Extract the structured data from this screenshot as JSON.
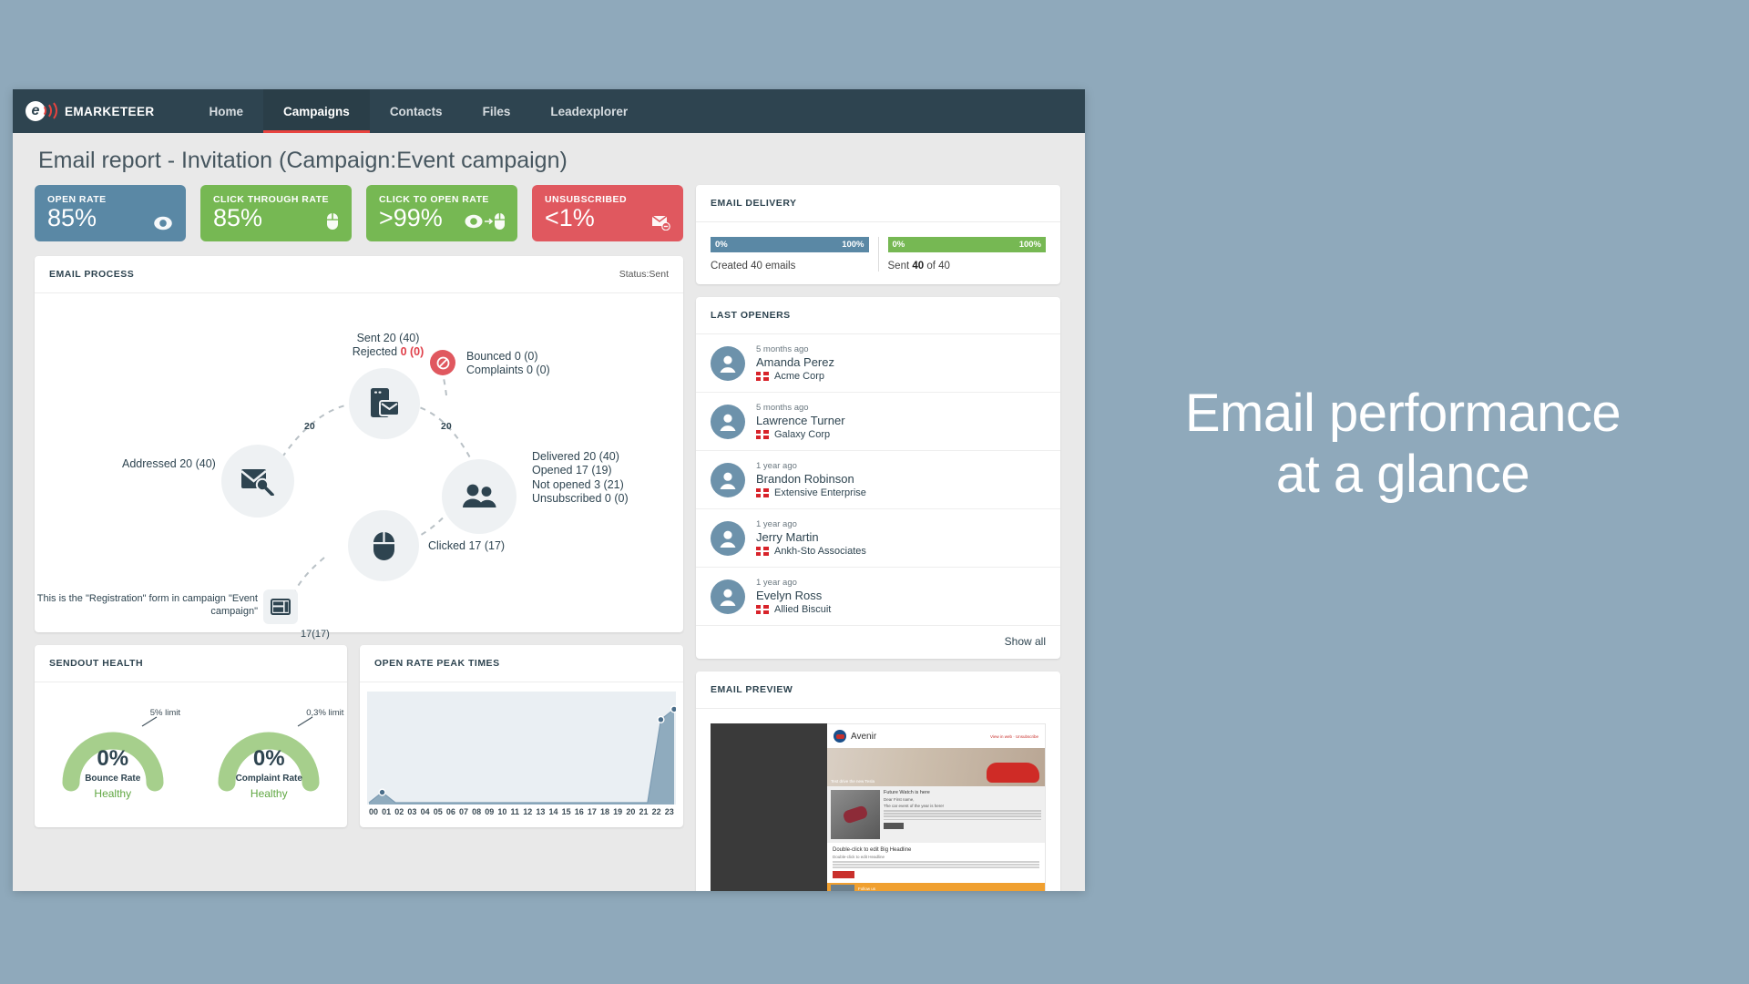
{
  "promo": {
    "line1": "Email performance",
    "line2": "at a glance"
  },
  "nav": {
    "brand": "EMARKETEER",
    "items": [
      {
        "label": "Home",
        "active": false
      },
      {
        "label": "Campaigns",
        "active": true
      },
      {
        "label": "Contacts",
        "active": false
      },
      {
        "label": "Files",
        "active": false
      },
      {
        "label": "Leadexplorer",
        "active": false
      }
    ]
  },
  "page": {
    "title": "Email report - Invitation (Campaign:Event campaign)"
  },
  "kpis": [
    {
      "label": "OPEN RATE",
      "value": "85%",
      "color": "#5a88a5",
      "icon": "eye-icon"
    },
    {
      "label": "CLICK THROUGH RATE",
      "value": "85%",
      "color": "#76b853",
      "icon": "mouse-icon"
    },
    {
      "label": "CLICK TO OPEN RATE",
      "value": ">99%",
      "color": "#76b853",
      "icon": "eye-to-mouse-icon"
    },
    {
      "label": "UNSUBSCRIBED",
      "value": "<1%",
      "color": "#e0585f",
      "icon": "unsubscribe-icon"
    }
  ],
  "process": {
    "title": "EMAIL PROCESS",
    "status": "Status:Sent",
    "addressed": "Addressed 20 (40)",
    "sent_line1": "Sent 20 (40)",
    "sent_line2_label": "Rejected",
    "sent_line2_value": "0 (0)",
    "bounced": "Bounced 0 (0)",
    "complaints": "Complaints 0 (0)",
    "delivered": "Delivered 20 (40)",
    "opened": "Opened 17 (19)",
    "not_opened": "Not opened 3 (21)",
    "unsubscribed": "Unsubscribed 0 (0)",
    "clicked": "Clicked 17 (17)",
    "edge_left": "20",
    "edge_right": "20",
    "form_count": "17(17)",
    "form_note": "This is the \"Registration\" form in campaign \"Event campaign\""
  },
  "sendout": {
    "title": "SENDOUT HEALTH",
    "gauges": [
      {
        "value": "0%",
        "caption": "Bounce Rate",
        "health": "Healthy",
        "limit": "5% limit"
      },
      {
        "value": "0%",
        "caption": "Complaint Rate",
        "health": "Healthy",
        "limit": "0,3% limit"
      }
    ]
  },
  "delivery": {
    "title": "EMAIL DELIVERY",
    "left": {
      "start": "0%",
      "end": "100%",
      "caption": "Created 40 emails"
    },
    "right": {
      "start": "0%",
      "end": "100%",
      "caption_pre": "Sent ",
      "caption_bold": "40",
      "caption_post": " of 40"
    }
  },
  "openers": {
    "title": "LAST OPENERS",
    "show_all": "Show all",
    "items": [
      {
        "ago": "5 months ago",
        "name": "Amanda Perez",
        "company": "Acme Corp"
      },
      {
        "ago": "5 months ago",
        "name": "Lawrence Turner",
        "company": "Galaxy Corp"
      },
      {
        "ago": "1 year ago",
        "name": "Brandon Robinson",
        "company": "Extensive Enterprise"
      },
      {
        "ago": "1 year ago",
        "name": "Jerry Martin",
        "company": "Ankh-Sto Associates"
      },
      {
        "ago": "1 year ago",
        "name": "Evelyn Ross",
        "company": "Allied Biscuit"
      }
    ]
  },
  "preview": {
    "title": "EMAIL PREVIEW",
    "brand": "Avenir",
    "links": "View in web  ·  Unsubscribe",
    "hero_caption": "Test drive the new Tesla",
    "section_head": "Future Watch is here",
    "section_sub1": "Dear First name,",
    "section_sub2": "The car event of the year is here!",
    "section_btn": "Sign up here",
    "foot_head": "Double-click to edit Big Headline",
    "foot_sub": "Double-click to edit Headline",
    "foot_btn": "Read more",
    "bar_text": "Follow us"
  },
  "chart_data": {
    "type": "area",
    "title": "OPEN RATE PEAK TIMES",
    "xlabel": "",
    "ylabel": "",
    "grid": false,
    "legend": "none",
    "categories": [
      "00",
      "01",
      "02",
      "03",
      "04",
      "05",
      "06",
      "07",
      "08",
      "09",
      "10",
      "11",
      "12",
      "13",
      "14",
      "15",
      "16",
      "17",
      "18",
      "19",
      "20",
      "21",
      "22",
      "23"
    ],
    "values": [
      0,
      1,
      0,
      0,
      0,
      0,
      0,
      0,
      0,
      0,
      0,
      0,
      0,
      0,
      0,
      0,
      0,
      0,
      0,
      0,
      0,
      0,
      8,
      9
    ],
    "ylim": [
      0,
      10
    ],
    "markers": [
      {
        "x": "01",
        "y": 1
      },
      {
        "x": "22",
        "y": 8
      },
      {
        "x": "23",
        "y": 9
      }
    ],
    "series_color": "#8aa6bb"
  }
}
